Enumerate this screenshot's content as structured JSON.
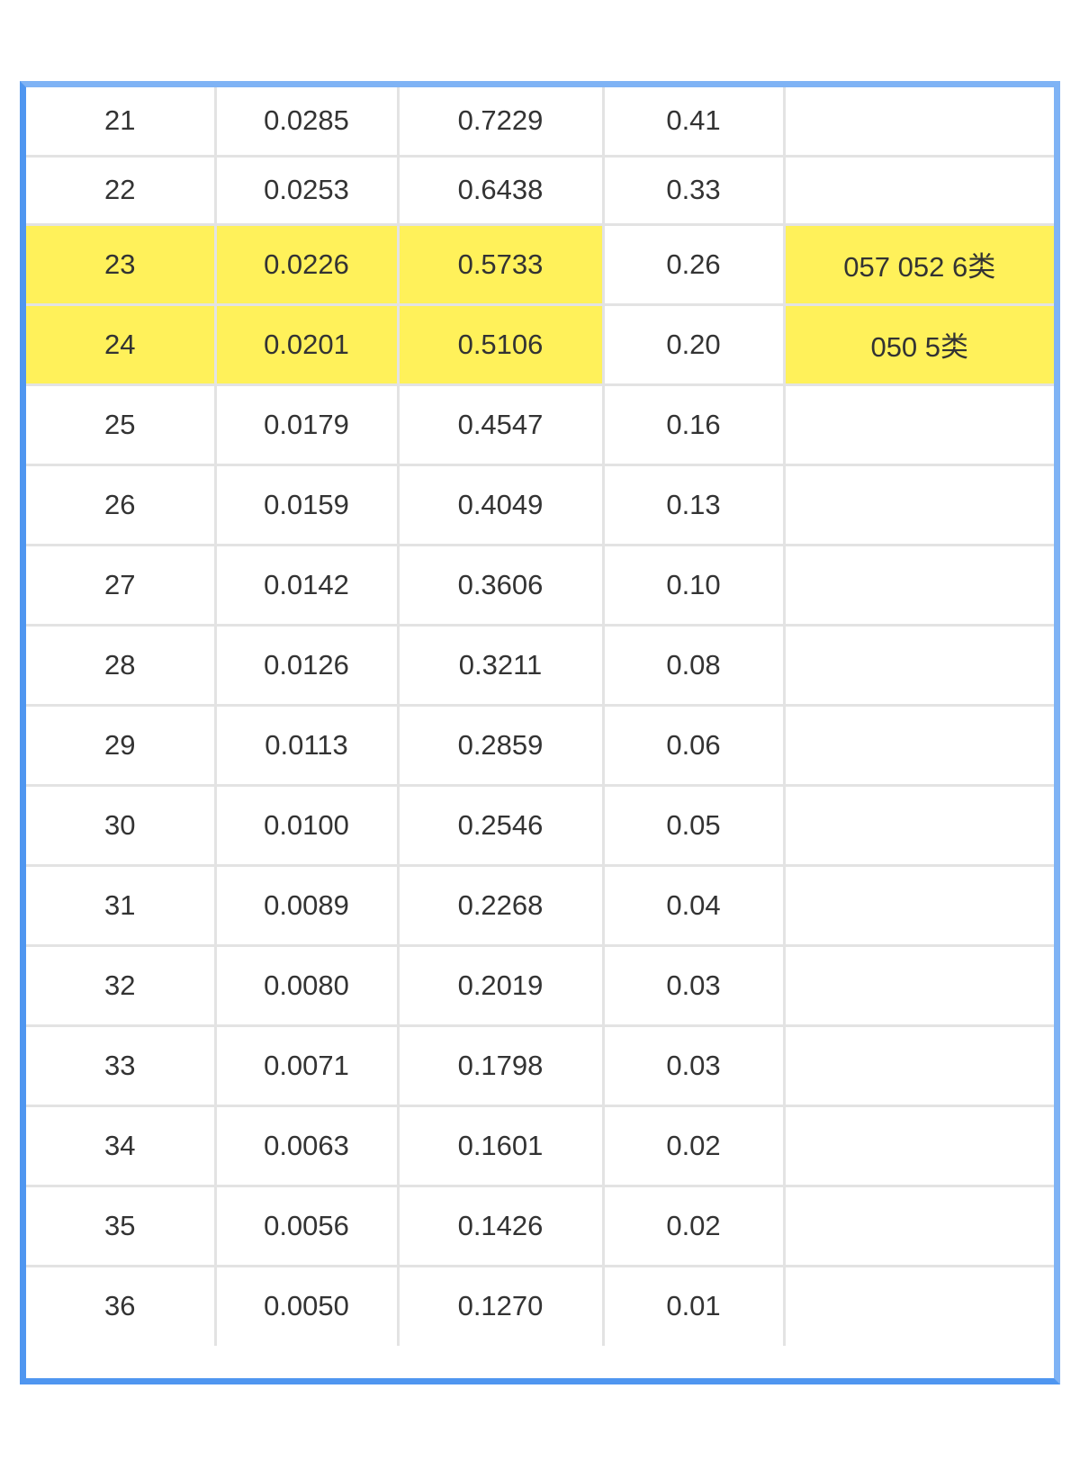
{
  "table": {
    "rows": [
      {
        "cells": [
          "21",
          "0.0285",
          "0.7229",
          "0.41",
          ""
        ],
        "highlight": [
          false,
          false,
          false,
          false,
          false
        ]
      },
      {
        "cells": [
          "22",
          "0.0253",
          "0.6438",
          "0.33",
          ""
        ],
        "highlight": [
          false,
          false,
          false,
          false,
          false
        ]
      },
      {
        "cells": [
          "23",
          "0.0226",
          "0.5733",
          "0.26",
          "057 052 6类"
        ],
        "highlight": [
          true,
          true,
          true,
          false,
          true
        ]
      },
      {
        "cells": [
          "24",
          "0.0201",
          "0.5106",
          "0.20",
          "050  5类"
        ],
        "highlight": [
          true,
          true,
          true,
          false,
          true
        ]
      },
      {
        "cells": [
          "25",
          "0.0179",
          "0.4547",
          "0.16",
          ""
        ],
        "highlight": [
          false,
          false,
          false,
          false,
          false
        ]
      },
      {
        "cells": [
          "26",
          "0.0159",
          "0.4049",
          "0.13",
          ""
        ],
        "highlight": [
          false,
          false,
          false,
          false,
          false
        ]
      },
      {
        "cells": [
          "27",
          "0.0142",
          "0.3606",
          "0.10",
          ""
        ],
        "highlight": [
          false,
          false,
          false,
          false,
          false
        ]
      },
      {
        "cells": [
          "28",
          "0.0126",
          "0.3211",
          "0.08",
          ""
        ],
        "highlight": [
          false,
          false,
          false,
          false,
          false
        ]
      },
      {
        "cells": [
          "29",
          "0.0113",
          "0.2859",
          "0.06",
          ""
        ],
        "highlight": [
          false,
          false,
          false,
          false,
          false
        ]
      },
      {
        "cells": [
          "30",
          "0.0100",
          "0.2546",
          "0.05",
          ""
        ],
        "highlight": [
          false,
          false,
          false,
          false,
          false
        ]
      },
      {
        "cells": [
          "31",
          "0.0089",
          "0.2268",
          "0.04",
          ""
        ],
        "highlight": [
          false,
          false,
          false,
          false,
          false
        ]
      },
      {
        "cells": [
          "32",
          "0.0080",
          "0.2019",
          "0.03",
          ""
        ],
        "highlight": [
          false,
          false,
          false,
          false,
          false
        ]
      },
      {
        "cells": [
          "33",
          "0.0071",
          "0.1798",
          "0.03",
          ""
        ],
        "highlight": [
          false,
          false,
          false,
          false,
          false
        ]
      },
      {
        "cells": [
          "34",
          "0.0063",
          "0.1601",
          "0.02",
          ""
        ],
        "highlight": [
          false,
          false,
          false,
          false,
          false
        ]
      },
      {
        "cells": [
          "35",
          "0.0056",
          "0.1426",
          "0.02",
          ""
        ],
        "highlight": [
          false,
          false,
          false,
          false,
          false
        ]
      },
      {
        "cells": [
          "36",
          "0.0050",
          "0.1270",
          "0.01",
          ""
        ],
        "highlight": [
          false,
          false,
          false,
          false,
          false
        ]
      }
    ]
  },
  "colors": {
    "highlight": "#fff15a",
    "frame": "#4f96f0",
    "grid": "#e3e3e3"
  }
}
